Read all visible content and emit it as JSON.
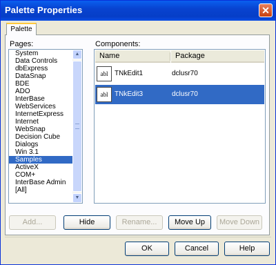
{
  "window": {
    "title": "Palette Properties",
    "close_glyph": "✕"
  },
  "tabs": [
    {
      "label": "Palette"
    }
  ],
  "pages": {
    "label": "Pages:",
    "items": [
      "System",
      "Data Controls",
      "dbExpress",
      "DataSnap",
      "BDE",
      "ADO",
      "InterBase",
      "WebServices",
      "InternetExpress",
      "Internet",
      "WebSnap",
      "Decision Cube",
      "Dialogs",
      "Win 3.1",
      "Samples",
      "ActiveX",
      "COM+",
      "InterBase Admin",
      "[All]"
    ],
    "selected_index": 14
  },
  "components": {
    "label": "Components:",
    "columns": [
      "Name",
      "Package"
    ],
    "rows": [
      {
        "icon": "abl",
        "name": "TNkEdit1",
        "package": "dclusr70"
      },
      {
        "icon": "abl",
        "name": "TNkEdit3",
        "package": "dclusr70"
      }
    ],
    "selected_index": 1
  },
  "actions": {
    "add": "Add...",
    "hide": "Hide",
    "rename": "Rename...",
    "move_up": "Move Up",
    "move_down": "Move Down"
  },
  "dialog": {
    "ok": "OK",
    "cancel": "Cancel",
    "help": "Help"
  }
}
